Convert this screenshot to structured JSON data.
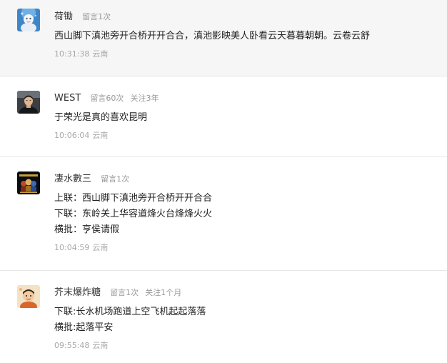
{
  "comments": [
    {
      "user": "荷锄",
      "meta": [
        "留言1次"
      ],
      "lines": [
        "西山脚下滇池旁开合桥开开合合，滇池影映美人卧看云天暮暮朝朝。云卷云舒"
      ],
      "time": "10:31:38",
      "location": "云南",
      "avatar_icon": "cartoon-character-avatar"
    },
    {
      "user": "WEST",
      "meta": [
        "留言60次",
        "关注3年"
      ],
      "lines": [
        "于荣光是真的喜欢昆明"
      ],
      "time": "10:06:04",
      "location": "云南",
      "avatar_icon": "man-portrait-avatar"
    },
    {
      "user": "凄水數三",
      "meta": [
        "留言1次"
      ],
      "lines": [
        "上联：西山脚下滇池旁开合桥开开合合",
        "下联：东岭关上华容道烽火台烽烽火火",
        "横批：亨侯请假"
      ],
      "time": "10:04:59",
      "location": "云南",
      "avatar_icon": "dark-poster-avatar"
    },
    {
      "user": "芥末爆炸糖",
      "meta": [
        "留言1次",
        "关注1个月"
      ],
      "lines": [
        "下联:长水机场跑道上空飞机起起落落",
        "横批:起落平安"
      ],
      "time": "09:55:48",
      "location": "云南",
      "avatar_icon": "character-illustration-avatar"
    }
  ]
}
